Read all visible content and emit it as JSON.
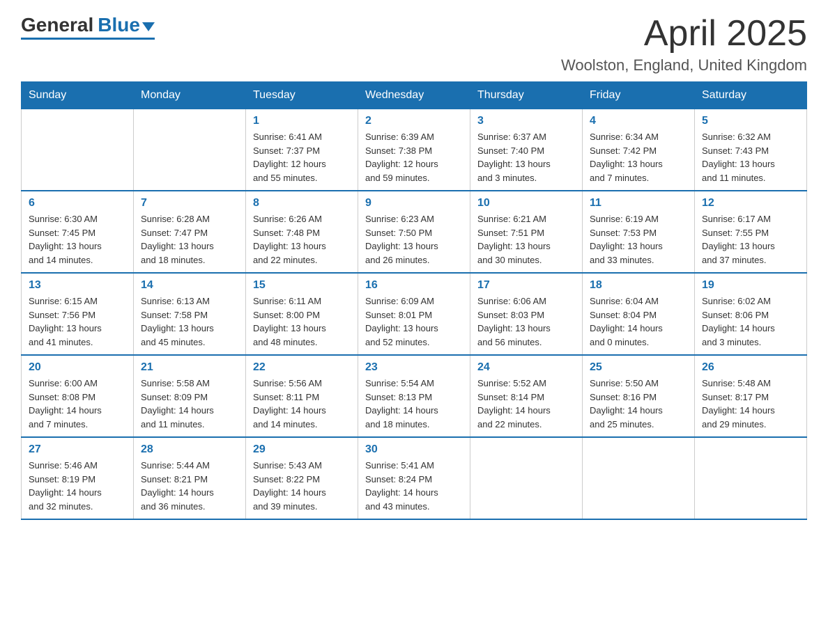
{
  "header": {
    "logo_general": "General",
    "logo_blue": "Blue",
    "month_title": "April 2025",
    "location": "Woolston, England, United Kingdom"
  },
  "days_of_week": [
    "Sunday",
    "Monday",
    "Tuesday",
    "Wednesday",
    "Thursday",
    "Friday",
    "Saturday"
  ],
  "weeks": [
    [
      {
        "day": "",
        "info": ""
      },
      {
        "day": "",
        "info": ""
      },
      {
        "day": "1",
        "info": "Sunrise: 6:41 AM\nSunset: 7:37 PM\nDaylight: 12 hours\nand 55 minutes."
      },
      {
        "day": "2",
        "info": "Sunrise: 6:39 AM\nSunset: 7:38 PM\nDaylight: 12 hours\nand 59 minutes."
      },
      {
        "day": "3",
        "info": "Sunrise: 6:37 AM\nSunset: 7:40 PM\nDaylight: 13 hours\nand 3 minutes."
      },
      {
        "day": "4",
        "info": "Sunrise: 6:34 AM\nSunset: 7:42 PM\nDaylight: 13 hours\nand 7 minutes."
      },
      {
        "day": "5",
        "info": "Sunrise: 6:32 AM\nSunset: 7:43 PM\nDaylight: 13 hours\nand 11 minutes."
      }
    ],
    [
      {
        "day": "6",
        "info": "Sunrise: 6:30 AM\nSunset: 7:45 PM\nDaylight: 13 hours\nand 14 minutes."
      },
      {
        "day": "7",
        "info": "Sunrise: 6:28 AM\nSunset: 7:47 PM\nDaylight: 13 hours\nand 18 minutes."
      },
      {
        "day": "8",
        "info": "Sunrise: 6:26 AM\nSunset: 7:48 PM\nDaylight: 13 hours\nand 22 minutes."
      },
      {
        "day": "9",
        "info": "Sunrise: 6:23 AM\nSunset: 7:50 PM\nDaylight: 13 hours\nand 26 minutes."
      },
      {
        "day": "10",
        "info": "Sunrise: 6:21 AM\nSunset: 7:51 PM\nDaylight: 13 hours\nand 30 minutes."
      },
      {
        "day": "11",
        "info": "Sunrise: 6:19 AM\nSunset: 7:53 PM\nDaylight: 13 hours\nand 33 minutes."
      },
      {
        "day": "12",
        "info": "Sunrise: 6:17 AM\nSunset: 7:55 PM\nDaylight: 13 hours\nand 37 minutes."
      }
    ],
    [
      {
        "day": "13",
        "info": "Sunrise: 6:15 AM\nSunset: 7:56 PM\nDaylight: 13 hours\nand 41 minutes."
      },
      {
        "day": "14",
        "info": "Sunrise: 6:13 AM\nSunset: 7:58 PM\nDaylight: 13 hours\nand 45 minutes."
      },
      {
        "day": "15",
        "info": "Sunrise: 6:11 AM\nSunset: 8:00 PM\nDaylight: 13 hours\nand 48 minutes."
      },
      {
        "day": "16",
        "info": "Sunrise: 6:09 AM\nSunset: 8:01 PM\nDaylight: 13 hours\nand 52 minutes."
      },
      {
        "day": "17",
        "info": "Sunrise: 6:06 AM\nSunset: 8:03 PM\nDaylight: 13 hours\nand 56 minutes."
      },
      {
        "day": "18",
        "info": "Sunrise: 6:04 AM\nSunset: 8:04 PM\nDaylight: 14 hours\nand 0 minutes."
      },
      {
        "day": "19",
        "info": "Sunrise: 6:02 AM\nSunset: 8:06 PM\nDaylight: 14 hours\nand 3 minutes."
      }
    ],
    [
      {
        "day": "20",
        "info": "Sunrise: 6:00 AM\nSunset: 8:08 PM\nDaylight: 14 hours\nand 7 minutes."
      },
      {
        "day": "21",
        "info": "Sunrise: 5:58 AM\nSunset: 8:09 PM\nDaylight: 14 hours\nand 11 minutes."
      },
      {
        "day": "22",
        "info": "Sunrise: 5:56 AM\nSunset: 8:11 PM\nDaylight: 14 hours\nand 14 minutes."
      },
      {
        "day": "23",
        "info": "Sunrise: 5:54 AM\nSunset: 8:13 PM\nDaylight: 14 hours\nand 18 minutes."
      },
      {
        "day": "24",
        "info": "Sunrise: 5:52 AM\nSunset: 8:14 PM\nDaylight: 14 hours\nand 22 minutes."
      },
      {
        "day": "25",
        "info": "Sunrise: 5:50 AM\nSunset: 8:16 PM\nDaylight: 14 hours\nand 25 minutes."
      },
      {
        "day": "26",
        "info": "Sunrise: 5:48 AM\nSunset: 8:17 PM\nDaylight: 14 hours\nand 29 minutes."
      }
    ],
    [
      {
        "day": "27",
        "info": "Sunrise: 5:46 AM\nSunset: 8:19 PM\nDaylight: 14 hours\nand 32 minutes."
      },
      {
        "day": "28",
        "info": "Sunrise: 5:44 AM\nSunset: 8:21 PM\nDaylight: 14 hours\nand 36 minutes."
      },
      {
        "day": "29",
        "info": "Sunrise: 5:43 AM\nSunset: 8:22 PM\nDaylight: 14 hours\nand 39 minutes."
      },
      {
        "day": "30",
        "info": "Sunrise: 5:41 AM\nSunset: 8:24 PM\nDaylight: 14 hours\nand 43 minutes."
      },
      {
        "day": "",
        "info": ""
      },
      {
        "day": "",
        "info": ""
      },
      {
        "day": "",
        "info": ""
      }
    ]
  ]
}
